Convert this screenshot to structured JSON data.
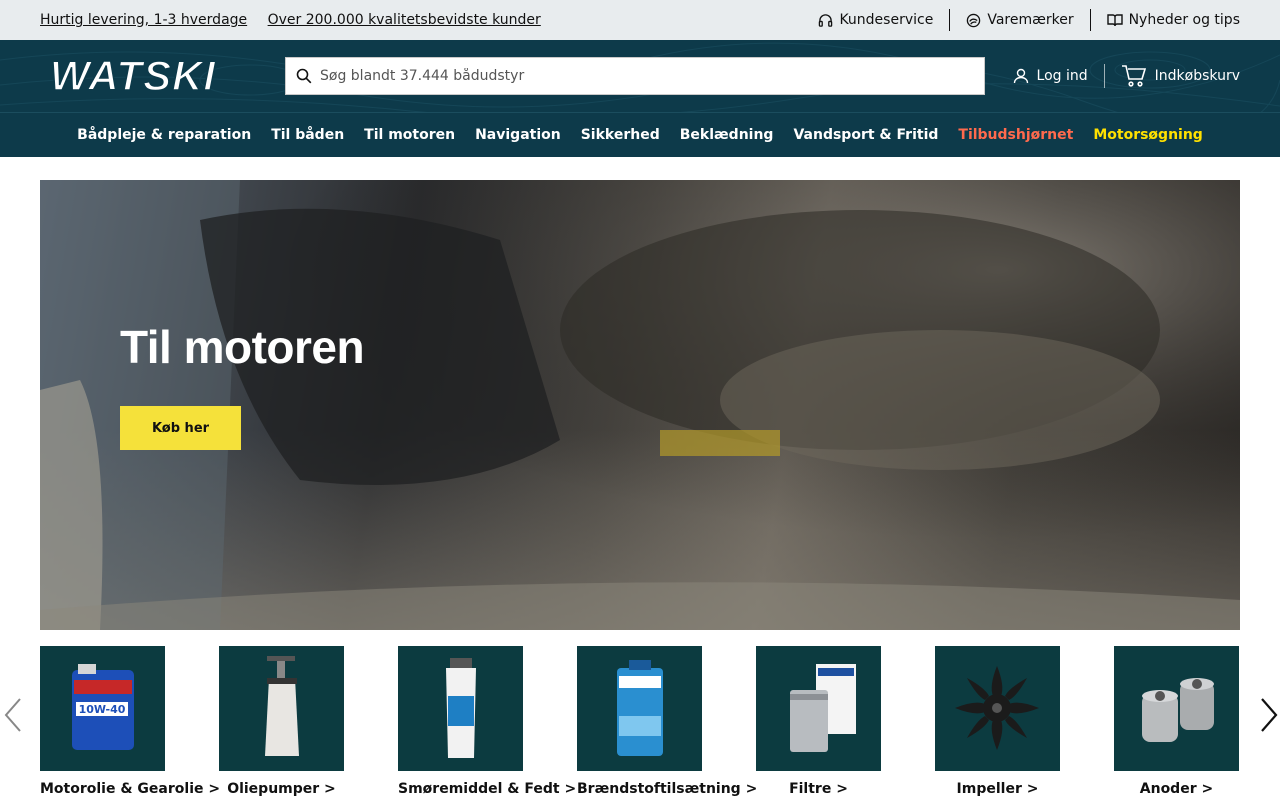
{
  "topbar": {
    "links_left": [
      "Hurtig levering, 1-3 hverdage",
      "Over 200.000 kvalitetsbevidste kunder"
    ],
    "customer_service": "Kundeservice",
    "brands": "Varemærker",
    "news": "Nyheder og tips"
  },
  "header": {
    "logo_text": "WATSKI",
    "search_placeholder": "Søg blandt 37.444 bådudstyr",
    "login": "Log ind",
    "cart": "Indkøbskurv"
  },
  "nav": {
    "items": [
      "Bådpleje & reparation",
      "Til båden",
      "Til motoren",
      "Navigation",
      "Sikkerhed",
      "Beklædning",
      "Vandsport & Fritid",
      "Tilbudshjørnet",
      "Motorsøgning"
    ]
  },
  "hero": {
    "title": "Til motoren",
    "cta": "Køb her"
  },
  "categories": [
    {
      "label": "Motorolie & Gearolie >",
      "icon": "oil-bottle-icon"
    },
    {
      "label": "Oliepumper >",
      "icon": "oil-pump-icon"
    },
    {
      "label": "Smøremiddel & Fedt >",
      "icon": "grease-tube-icon"
    },
    {
      "label": "Brændstoftilsætning >",
      "icon": "fuel-additive-icon"
    },
    {
      "label": "Filtre >",
      "icon": "filter-icon"
    },
    {
      "label": "Impeller >",
      "icon": "impeller-icon"
    },
    {
      "label": "Anoder >",
      "icon": "anode-icon"
    }
  ],
  "colors": {
    "header_bg": "#0d3a4a",
    "offer": "#ff6a4d",
    "motor_search": "#ffe100",
    "cta": "#f5e13a",
    "tile_bg": "#0c3b40"
  }
}
